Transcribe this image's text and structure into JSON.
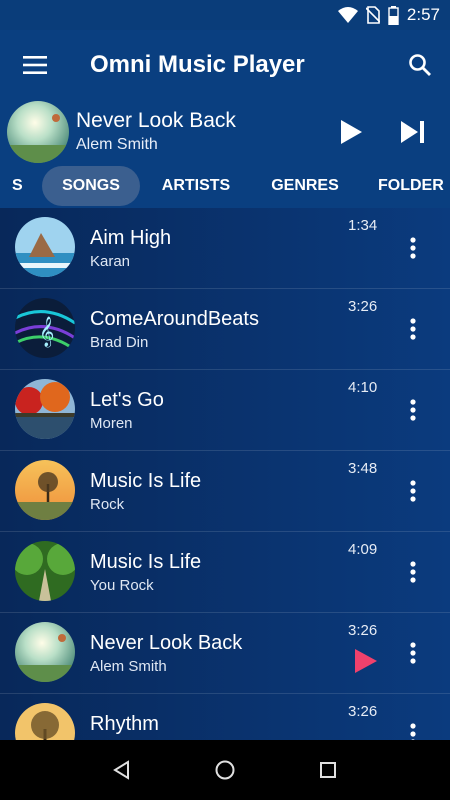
{
  "status_bar": {
    "time": "2:57",
    "icons": [
      "wifi-icon",
      "no-sim-icon",
      "battery-icon"
    ]
  },
  "app_bar": {
    "title": "Omni Music Player",
    "menu_icon": "hamburger-menu-icon",
    "search_icon": "search-icon"
  },
  "now_playing": {
    "title": "Never Look Back",
    "artist": "Alem Smith",
    "play_icon": "play-icon",
    "next_icon": "skip-next-icon"
  },
  "tabs": [
    {
      "label": "S"
    },
    {
      "label": "SONGS",
      "selected": true
    },
    {
      "label": "ARTISTS"
    },
    {
      "label": "GENRES"
    },
    {
      "label": "FOLDER"
    }
  ],
  "songs": [
    {
      "title": "Aim High",
      "artist": "Karan",
      "duration": "1:34"
    },
    {
      "title": "ComeAroundBeats",
      "artist": "Brad Din",
      "duration": "3:26"
    },
    {
      "title": "Let's Go",
      "artist": "Moren",
      "duration": "4:10"
    },
    {
      "title": "Music Is Life",
      "artist": "Rock",
      "duration": "3:48"
    },
    {
      "title": "Music Is Life",
      "artist": "You Rock",
      "duration": "4:09"
    },
    {
      "title": "Never Look Back",
      "artist": "Alem Smith",
      "duration": "3:26",
      "playing": true
    },
    {
      "title": "Rhythm",
      "artist": "",
      "duration": "3:26"
    }
  ],
  "colors": {
    "app_bar": "#0a3f80",
    "selected_tab": "#3b5f8f",
    "playing_accent": "#f0416c",
    "list_bg": "#08285a"
  },
  "nav_bar": {
    "icons": [
      "back-icon",
      "home-icon",
      "recents-icon"
    ]
  }
}
